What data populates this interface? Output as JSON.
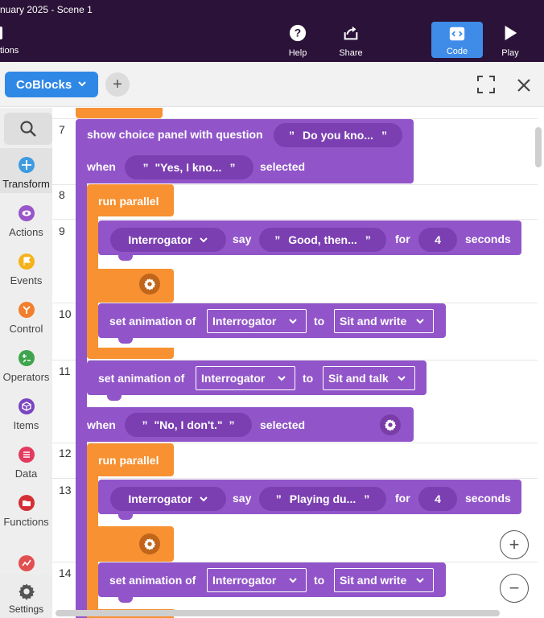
{
  "window": {
    "title": "nuary 2025 - Scene 1",
    "left_label": "tions"
  },
  "topbar": {
    "help": "Help",
    "share": "Share",
    "code": "Code",
    "play": "Play"
  },
  "toolbar": {
    "library": "CoBlocks",
    "add": "+"
  },
  "sidebar": {
    "categories": [
      {
        "label": "Transform",
        "color": "#3d9be0"
      },
      {
        "label": "Actions",
        "color": "#9a55c9"
      },
      {
        "label": "Events",
        "color": "#f5b21a"
      },
      {
        "label": "Control",
        "color": "#f27f2e"
      },
      {
        "label": "Operators",
        "color": "#3ea44d"
      },
      {
        "label": "Items",
        "color": "#7a45c2"
      },
      {
        "label": "Data",
        "color": "#e23b5e"
      },
      {
        "label": "Functions",
        "color": "#d52f36"
      },
      {
        "label": "",
        "color": "#e24f4f"
      }
    ],
    "settings": "Settings"
  },
  "code": {
    "line_numbers": [
      "7",
      "8",
      "9",
      "10",
      "11",
      "12",
      "13",
      "14"
    ],
    "choice_panel": "show choice panel with question",
    "question": "Do you kno...",
    "when": "when",
    "selected": "selected",
    "option_yes": "\"Yes, I kno...",
    "option_no": "\"No, I don't.\"",
    "run_parallel": "run parallel",
    "interrogator": "Interrogator",
    "say": "say",
    "for": "for",
    "seconds": "seconds",
    "say1": "Good, then...",
    "say2": "Playing du...",
    "duration": "4",
    "set_animation": "set animation of",
    "to": "to",
    "anim_sit_write": "Sit and write",
    "anim_sit_talk": "Sit and talk",
    "quote": "”"
  },
  "zoom": {
    "in": "+",
    "out": "−"
  }
}
